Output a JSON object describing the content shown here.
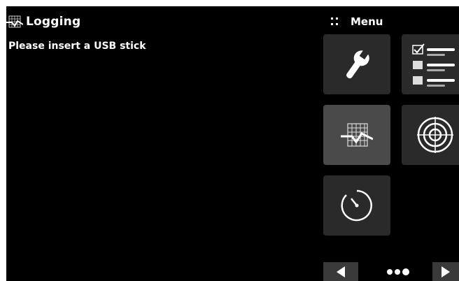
{
  "app": {
    "title": "Logging",
    "message": "Please insert a USB stick"
  },
  "menu": {
    "label": "Menu",
    "tiles": [
      {
        "icon": "wrench-icon",
        "active": false
      },
      {
        "icon": "checklist-icon",
        "active": false
      },
      {
        "icon": "logging-icon",
        "active": true
      },
      {
        "icon": "target-icon",
        "active": false
      },
      {
        "icon": "timer-icon",
        "active": false
      }
    ]
  },
  "pagination": {
    "prev_icon": "arrow-left-icon",
    "next_icon": "arrow-right-icon",
    "page_indicator_icon": "page-dots-icon"
  },
  "colors": {
    "background": "#000000",
    "tile": "#2a2a2a",
    "tile_active": "#4a4a4a",
    "text": "#ffffff"
  }
}
